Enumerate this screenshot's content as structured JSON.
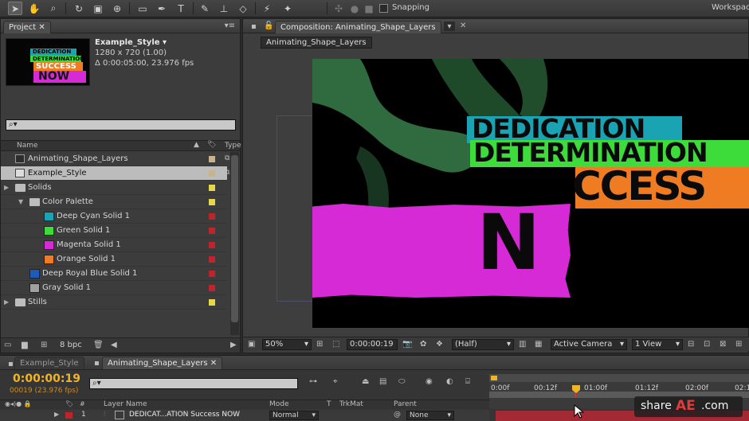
{
  "toolbar": {
    "snapping_label": "Snapping",
    "workspace_label": "Workspac"
  },
  "project": {
    "tab_label": "Project",
    "comp_name": "Example_Style ▾",
    "comp_size": "1280 x 720 (1.00)",
    "comp_duration": "Δ 0:00:05:00, 23.976 fps",
    "thumb_lines": [
      "DEDICATION",
      "DETERMINATION",
      "SUCCESS",
      "NOW"
    ],
    "search_placeholder": "⌕▾",
    "col_name": "Name",
    "col_type": "Type",
    "bpc": "8 bpc",
    "items": [
      {
        "name": "Animating_Shape_Layers",
        "kind": "comp",
        "label_color": "#c8b48a",
        "type": "C"
      },
      {
        "name": "Example_Style",
        "kind": "comp",
        "label_color": "#c8b48a",
        "type": "C",
        "selected": true
      },
      {
        "name": "Solids",
        "kind": "folder",
        "label_color": "#e6d84a",
        "type": "F"
      },
      {
        "name": "Color Palette",
        "kind": "folder",
        "label_color": "#e6d84a",
        "type": "F"
      },
      {
        "name": "Deep Cyan Solid 1",
        "kind": "solid",
        "swatch": "#1aa3b3",
        "label_color": "#c0242b",
        "type": "S"
      },
      {
        "name": "Green Solid 1",
        "kind": "solid",
        "swatch": "#3ddc3a",
        "label_color": "#c0242b",
        "type": "S"
      },
      {
        "name": "Magenta Solid 1",
        "kind": "solid",
        "swatch": "#d72ad7",
        "label_color": "#c0242b",
        "type": "S"
      },
      {
        "name": "Orange Solid 1",
        "kind": "solid",
        "swatch": "#ef7c22",
        "label_color": "#c0242b",
        "type": "S"
      },
      {
        "name": "Deep Royal Blue Solid 1",
        "kind": "solid",
        "swatch": "#1e5bb8",
        "label_color": "#c0242b",
        "type": "S"
      },
      {
        "name": "Gray Solid 1",
        "kind": "solid",
        "swatch": "#a0a0a0",
        "label_color": "#c0242b",
        "type": "S"
      },
      {
        "name": "Stills",
        "kind": "folder",
        "label_color": "#e6d84a",
        "type": "F"
      }
    ]
  },
  "composition": {
    "tab_label": "Composition: Animating_Shape_Layers",
    "sub_tab": "Animating_Shape_Layers",
    "canvas_text": {
      "line1": "DEDICATION",
      "line2": "DETERMINATION",
      "line3": "CCESS",
      "line4": "N"
    },
    "colors": {
      "cyan": "#1aa3b3",
      "green": "#3ddc3a",
      "orange": "#ef7c22",
      "magenta": "#d72ad7"
    },
    "zoom": "50%",
    "timecode": "0:00:00:19",
    "resolution": "(Half)",
    "camera": "Active Camera",
    "view": "1 View"
  },
  "timeline": {
    "tab_inactive": "Example_Style",
    "tab_active": "Animating_Shape_Layers",
    "timecode": "0:00:00:19",
    "frame_info": "00019 (23.976 fps)",
    "search_placeholder": "⌕▾",
    "ruler": [
      "0:00f",
      "00:12f",
      "01:00f",
      "01:12f",
      "02:00f",
      "02:1"
    ],
    "col_layer_name": "Layer Name",
    "col_mode": "Mode",
    "col_t": "T",
    "col_trkmat": "TrkMat",
    "col_parent": "Parent",
    "layer": {
      "index": "1",
      "name": "DEDICAT...ATION Success NOW",
      "mode": "Normal",
      "parent": "None"
    }
  },
  "watermark": {
    "prefix": "share",
    "brand": "AE",
    "suffix": ".com"
  }
}
